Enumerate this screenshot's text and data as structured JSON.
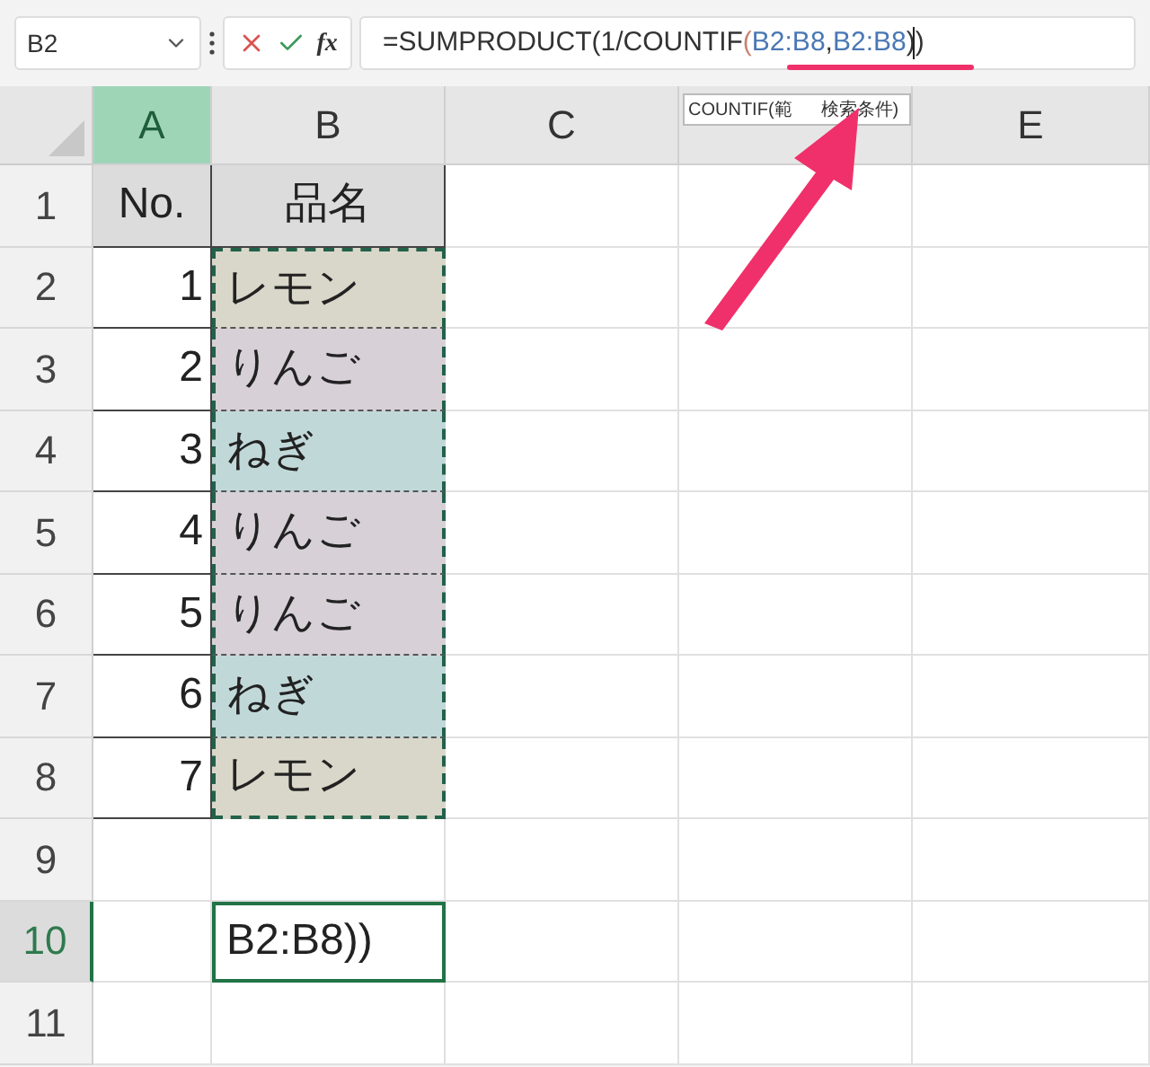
{
  "name_box": {
    "value": "B2"
  },
  "function_button": {
    "label": "fx"
  },
  "formula_bar": {
    "segments": [
      {
        "text": "=SUMPRODUCT(1/COUNTIF",
        "kind": "plain"
      },
      {
        "text": "(",
        "kind": "paren"
      },
      {
        "text": "B2:B8",
        "kind": "ref"
      },
      {
        "text": ",",
        "kind": "plain"
      },
      {
        "text": "B2:B8",
        "kind": "ref"
      },
      {
        "text": "))",
        "kind": "plain"
      }
    ]
  },
  "tooltip": {
    "parts": [
      "COUNTIF(範",
      "検索条件)"
    ]
  },
  "columns": [
    {
      "label": "A",
      "selected": true
    },
    {
      "label": "B",
      "selected": false
    },
    {
      "label": "C",
      "selected": false
    },
    {
      "selected": false
    },
    {
      "label": "E",
      "selected": false
    }
  ],
  "rows": [
    {
      "label": "1",
      "selected": false,
      "a": "No.",
      "b": "品名",
      "header": true
    },
    {
      "label": "2",
      "selected": false,
      "a": "1",
      "b": "レモン",
      "color": "#d9d7c9"
    },
    {
      "label": "3",
      "selected": false,
      "a": "2",
      "b": "りんご",
      "color": "#d7d0d7"
    },
    {
      "label": "4",
      "selected": false,
      "a": "3",
      "b": "ねぎ",
      "color": "#c1d8d9"
    },
    {
      "label": "5",
      "selected": false,
      "a": "4",
      "b": "りんご",
      "color": "#d7d0d7"
    },
    {
      "label": "6",
      "selected": false,
      "a": "5",
      "b": "りんご",
      "color": "#d7d0d7"
    },
    {
      "label": "7",
      "selected": false,
      "a": "6",
      "b": "ねぎ",
      "color": "#c1d8d9"
    },
    {
      "label": "8",
      "selected": false,
      "a": "7",
      "b": "レモン",
      "color": "#d9d7c9"
    },
    {
      "label": "9",
      "selected": false
    },
    {
      "label": "10",
      "selected": true,
      "b": "B2:B8))",
      "editing": true
    },
    {
      "label": "11",
      "selected": false
    }
  ]
}
